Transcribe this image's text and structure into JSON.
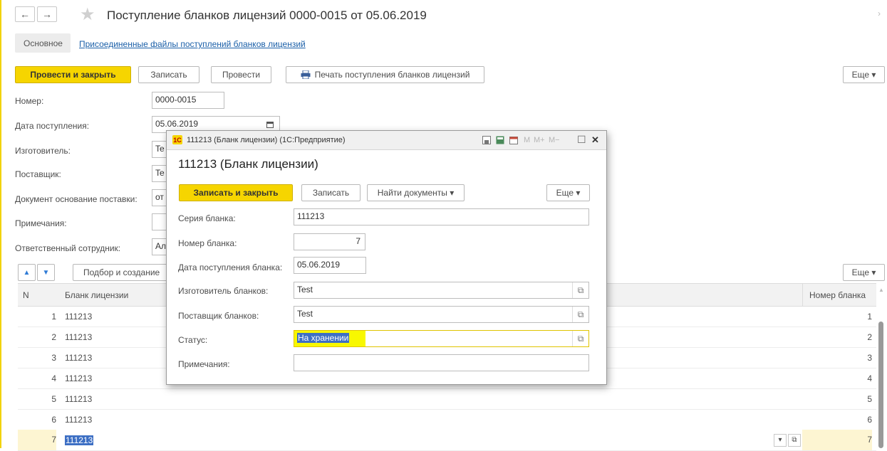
{
  "header": {
    "back_glyph": "←",
    "forward_glyph": "→",
    "star_glyph": "★",
    "title": "Поступление бланков лицензий 0000-0015 от 05.06.2019",
    "right_glyph": "›"
  },
  "tabs": {
    "main": "Основное",
    "files_link": "Присоединенные файлы поступлений бланков лицензий"
  },
  "toolbar": {
    "post_close": "Провести и закрыть",
    "write": "Записать",
    "post": "Провести",
    "print": "Печать поступления бланков лицензий",
    "more": "Еще ▾"
  },
  "form": {
    "number_label": "Номер:",
    "number_value": "0000-0015",
    "date_label": "Дата поступления:",
    "date_value": "05.06.2019",
    "maker_label": "Изготовитель:",
    "maker_value": "Te",
    "supplier_label": "Поставщик:",
    "supplier_value": "Te",
    "basis_label": "Документ основание поставки:",
    "basis_value": "от",
    "notes_label": "Примечания:",
    "notes_value": "",
    "resp_label": "Ответственный сотрудник:",
    "resp_value": "Ал"
  },
  "grid": {
    "up_glyph": "▲",
    "down_glyph": "▼",
    "pick_button": "Подбор и создание",
    "more": "Еще ▾",
    "columns": [
      "N",
      "Бланк лицензии",
      "Номер бланка"
    ],
    "rows": [
      {
        "n": "1",
        "blank": "111213",
        "num": "1"
      },
      {
        "n": "2",
        "blank": "111213",
        "num": "2"
      },
      {
        "n": "3",
        "blank": "111213",
        "num": "3"
      },
      {
        "n": "4",
        "blank": "111213",
        "num": "4"
      },
      {
        "n": "5",
        "blank": "111213",
        "num": "5"
      },
      {
        "n": "6",
        "blank": "111213",
        "num": "6"
      },
      {
        "n": "7",
        "blank": "111213",
        "num": "7"
      }
    ],
    "row_dropdown_glyph": "▾",
    "row_open_glyph": "⧉"
  },
  "dialog": {
    "logo_text": "1С",
    "window_title": "111213 (Бланк лицензии) (1С:Предприятие)",
    "toolbar_m": "M",
    "toolbar_mplus": "M+",
    "toolbar_mminus": "M−",
    "maximize_glyph": "☐",
    "close_glyph": "✕",
    "heading": "111213 (Бланк лицензии)",
    "write_close": "Записать и закрыть",
    "write": "Записать",
    "find_docs": "Найти документы ▾",
    "more": "Еще ▾",
    "series_label": "Серия бланка:",
    "series_value": "111213",
    "number_label": "Номер бланка:",
    "number_value": "7",
    "date_label": "Дата поступления бланка:",
    "date_value": "05.06.2019",
    "maker_label": "Изготовитель бланков:",
    "maker_value": "Test",
    "supplier_label": "Поставщик бланков:",
    "supplier_value": "Test",
    "status_label": "Статус:",
    "status_value": "На хранении",
    "notes_label": "Примечания:",
    "notes_value": "",
    "open_glyph": "⧉"
  },
  "colors": {
    "accent_yellow": "#f6d500",
    "link_blue": "#1a5fa8",
    "selection_blue": "#3d6fc4",
    "current_row": "#fdf5d2"
  }
}
